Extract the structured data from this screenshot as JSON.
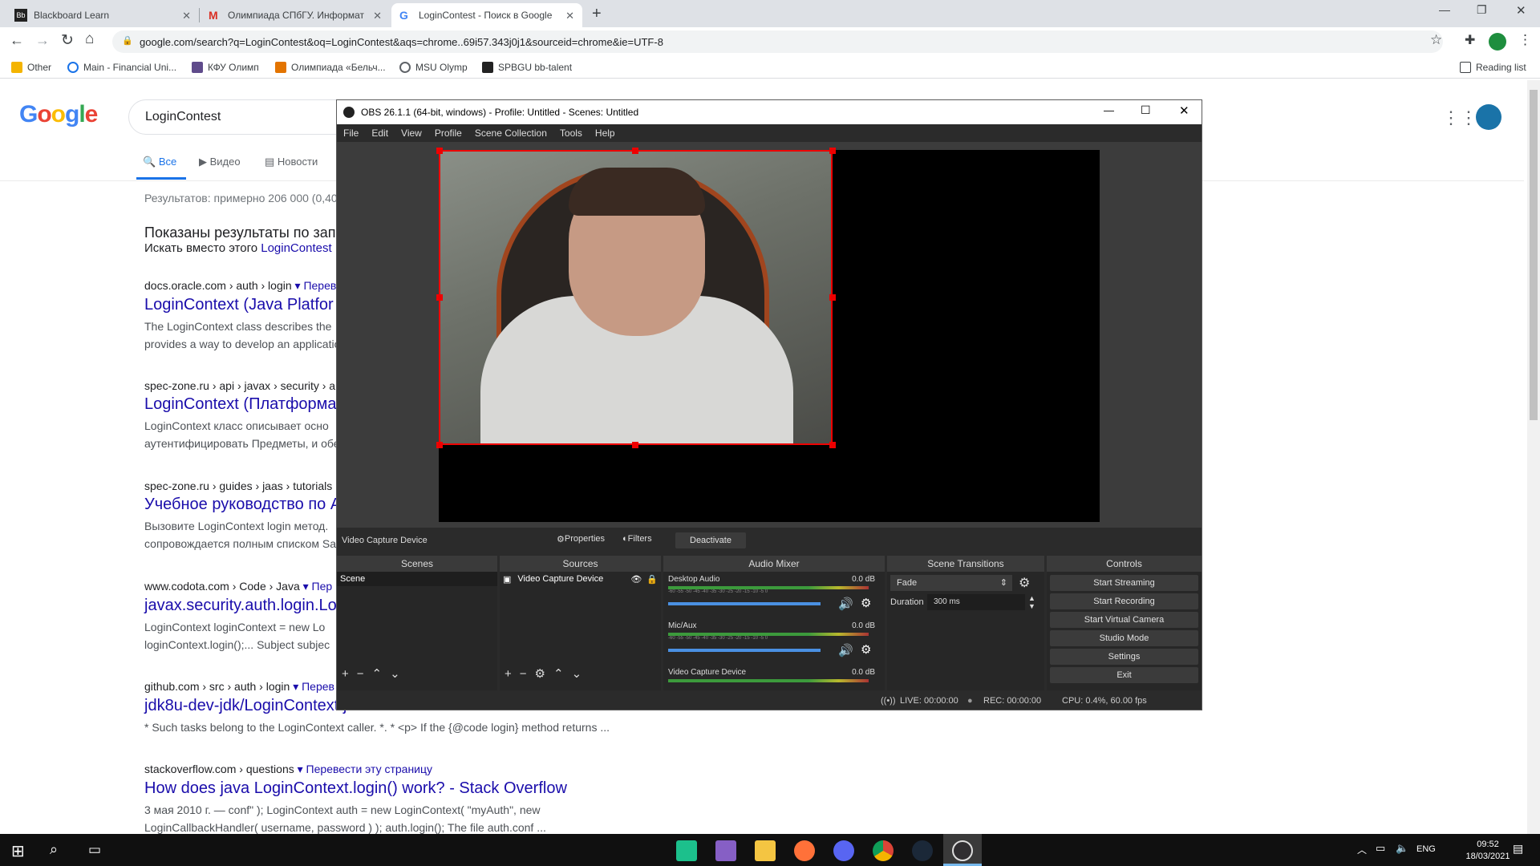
{
  "browser": {
    "tabs": [
      {
        "label": "Blackboard Learn",
        "active": false
      },
      {
        "label": "Олимпиада СПбГУ. Информати",
        "active": false
      },
      {
        "label": "LoginContest - Поиск в Google",
        "active": true
      }
    ],
    "url": "google.com/search?q=LoginContest&oq=LoginContest&aqs=chrome..69i57.343j0j1&sourceid=chrome&ie=UTF-8",
    "bookmarks": [
      "Other",
      "Main - Financial Uni...",
      "КФУ Олимп",
      "Олимпиада «Бельч...",
      "MSU Olymp",
      "SPBGU bb-talent"
    ],
    "reading_list": "Reading list"
  },
  "google": {
    "logo": "Google",
    "query": "LoginContest",
    "tabs": [
      "Все",
      "Видео",
      "Новости"
    ],
    "stats": "Результатов: примерно 206 000 (0,40",
    "showing": "Показаны результаты по зап",
    "instead_prefix": "Искать вместо этого",
    "instead_link": "LoginContest",
    "results": [
      {
        "cite": "docs.oracle.com › auth › login",
        "trans": "▾ Перев",
        "title": "LoginContext (Java Platfor",
        "snip1": "The LoginContext class describes the",
        "snip2": "provides a way to develop an applicatio"
      },
      {
        "cite": "spec-zone.ru › api › javax › security › a",
        "trans": "",
        "title": "LoginContext (Платформа",
        "snip1": "LoginContext класс описывает осно",
        "snip2": "аутентифицировать Предметы, и обе"
      },
      {
        "cite": "spec-zone.ru › guides › jaas › tutorials",
        "trans": "",
        "title": "Учебное руководство по A",
        "snip1": "Вызовите LoginContext login метод.",
        "snip2": "сопровождается полным списком Sa"
      },
      {
        "cite": "www.codota.com › Code › Java",
        "trans": "▾ Пер",
        "title": "javax.security.auth.login.Lo",
        "snip1": "LoginContext loginContext = new Lo",
        "snip2": "loginContext.login();... Subject subjec"
      },
      {
        "cite": "github.com › src › auth › login",
        "trans": "▾ Перев",
        "title": "jdk8u-dev-jdk/LoginContext.java at master · frohoff · GitHub",
        "snip1": "* Such tasks belong to the LoginContext caller. *. * <p> If the {@code login} method returns ...",
        "snip2": ""
      },
      {
        "cite": "stackoverflow.com › questions",
        "trans": "▾ Перевести эту страницу",
        "title": "How does java LoginContext.login() work? - Stack Overflow",
        "snip1": "3 мая 2010 г. — conf\" ); LoginContext auth = new LoginContext( \"myAuth\", new",
        "snip2": "LoginCallbackHandler( username, password ) ); auth.login(); The file auth.conf ..."
      }
    ]
  },
  "obs": {
    "title": "OBS 26.1.1 (64-bit, windows) - Profile: Untitled - Scenes: Untitled",
    "menu": [
      "File",
      "Edit",
      "View",
      "Profile",
      "Scene Collection",
      "Tools",
      "Help"
    ],
    "source_name": "Video Capture Device",
    "properties": "Properties",
    "filters": "Filters",
    "deactivate": "Deactivate",
    "docks": {
      "scenes": "Scenes",
      "sources": "Sources",
      "audio": "Audio Mixer",
      "transitions": "Scene Transitions",
      "controls": "Controls"
    },
    "scene_item": "Scene",
    "source_item": "Video Capture Device",
    "mixer": [
      {
        "name": "Desktop Audio",
        "db": "0.0 dB"
      },
      {
        "name": "Mic/Aux",
        "db": "0.0 dB"
      },
      {
        "name": "Video Capture Device",
        "db": "0.0 dB"
      }
    ],
    "meter_ticks": "-60 -55 -50 -45 -40 -35 -30 -25 -20 -15 -10 -5 0",
    "transition": "Fade",
    "duration_label": "Duration",
    "duration_value": "300 ms",
    "controls": [
      "Start Streaming",
      "Start Recording",
      "Start Virtual Camera",
      "Studio Mode",
      "Settings",
      "Exit"
    ],
    "status": {
      "live": "LIVE: 00:00:00",
      "rec": "REC: 00:00:00",
      "cpu": "CPU: 0.4%, 60.00 fps"
    }
  },
  "taskbar": {
    "lang": "ENG",
    "time": "09:52",
    "date": "18/03/2021"
  }
}
